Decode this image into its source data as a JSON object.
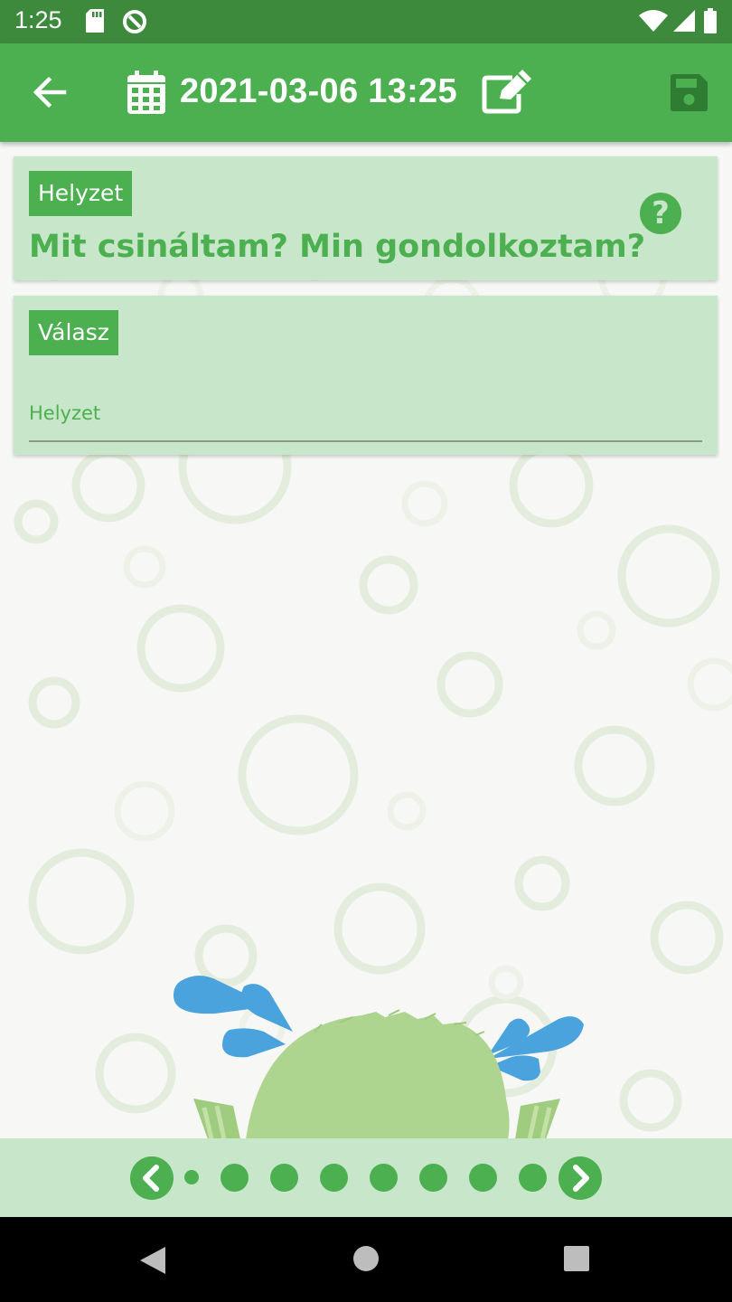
{
  "status_bar": {
    "time": "1:25",
    "icons": [
      "sd-card-icon",
      "sync-icon",
      "wifi-icon",
      "signal-icon",
      "battery-icon"
    ]
  },
  "toolbar": {
    "title": "2021-03-06 13:25",
    "icons": [
      "back-arrow-icon",
      "calendar-icon",
      "edit-icon",
      "save-icon"
    ]
  },
  "question_card": {
    "tag": "Helyzet",
    "question": "Mit csináltam? Min gondolkoztam?",
    "help_glyph": "?"
  },
  "answer_card": {
    "tag": "Válasz",
    "input_placeholder": "Helyzet",
    "input_value": ""
  },
  "pager": {
    "page_count": 8,
    "current_page": 1,
    "icons": [
      "chevron-left-icon",
      "chevron-right-icon"
    ]
  },
  "nav_bar": {
    "icons": [
      "back-triangle-icon",
      "home-circle-icon",
      "recents-square-icon"
    ]
  },
  "colors": {
    "status_bar": "#3e8a3d",
    "primary": "#4caf50",
    "card_background": "#c8e6c9",
    "save_icon": "#2e7d32",
    "drops": "#4aa3dc",
    "mascot": "#aed58f"
  }
}
